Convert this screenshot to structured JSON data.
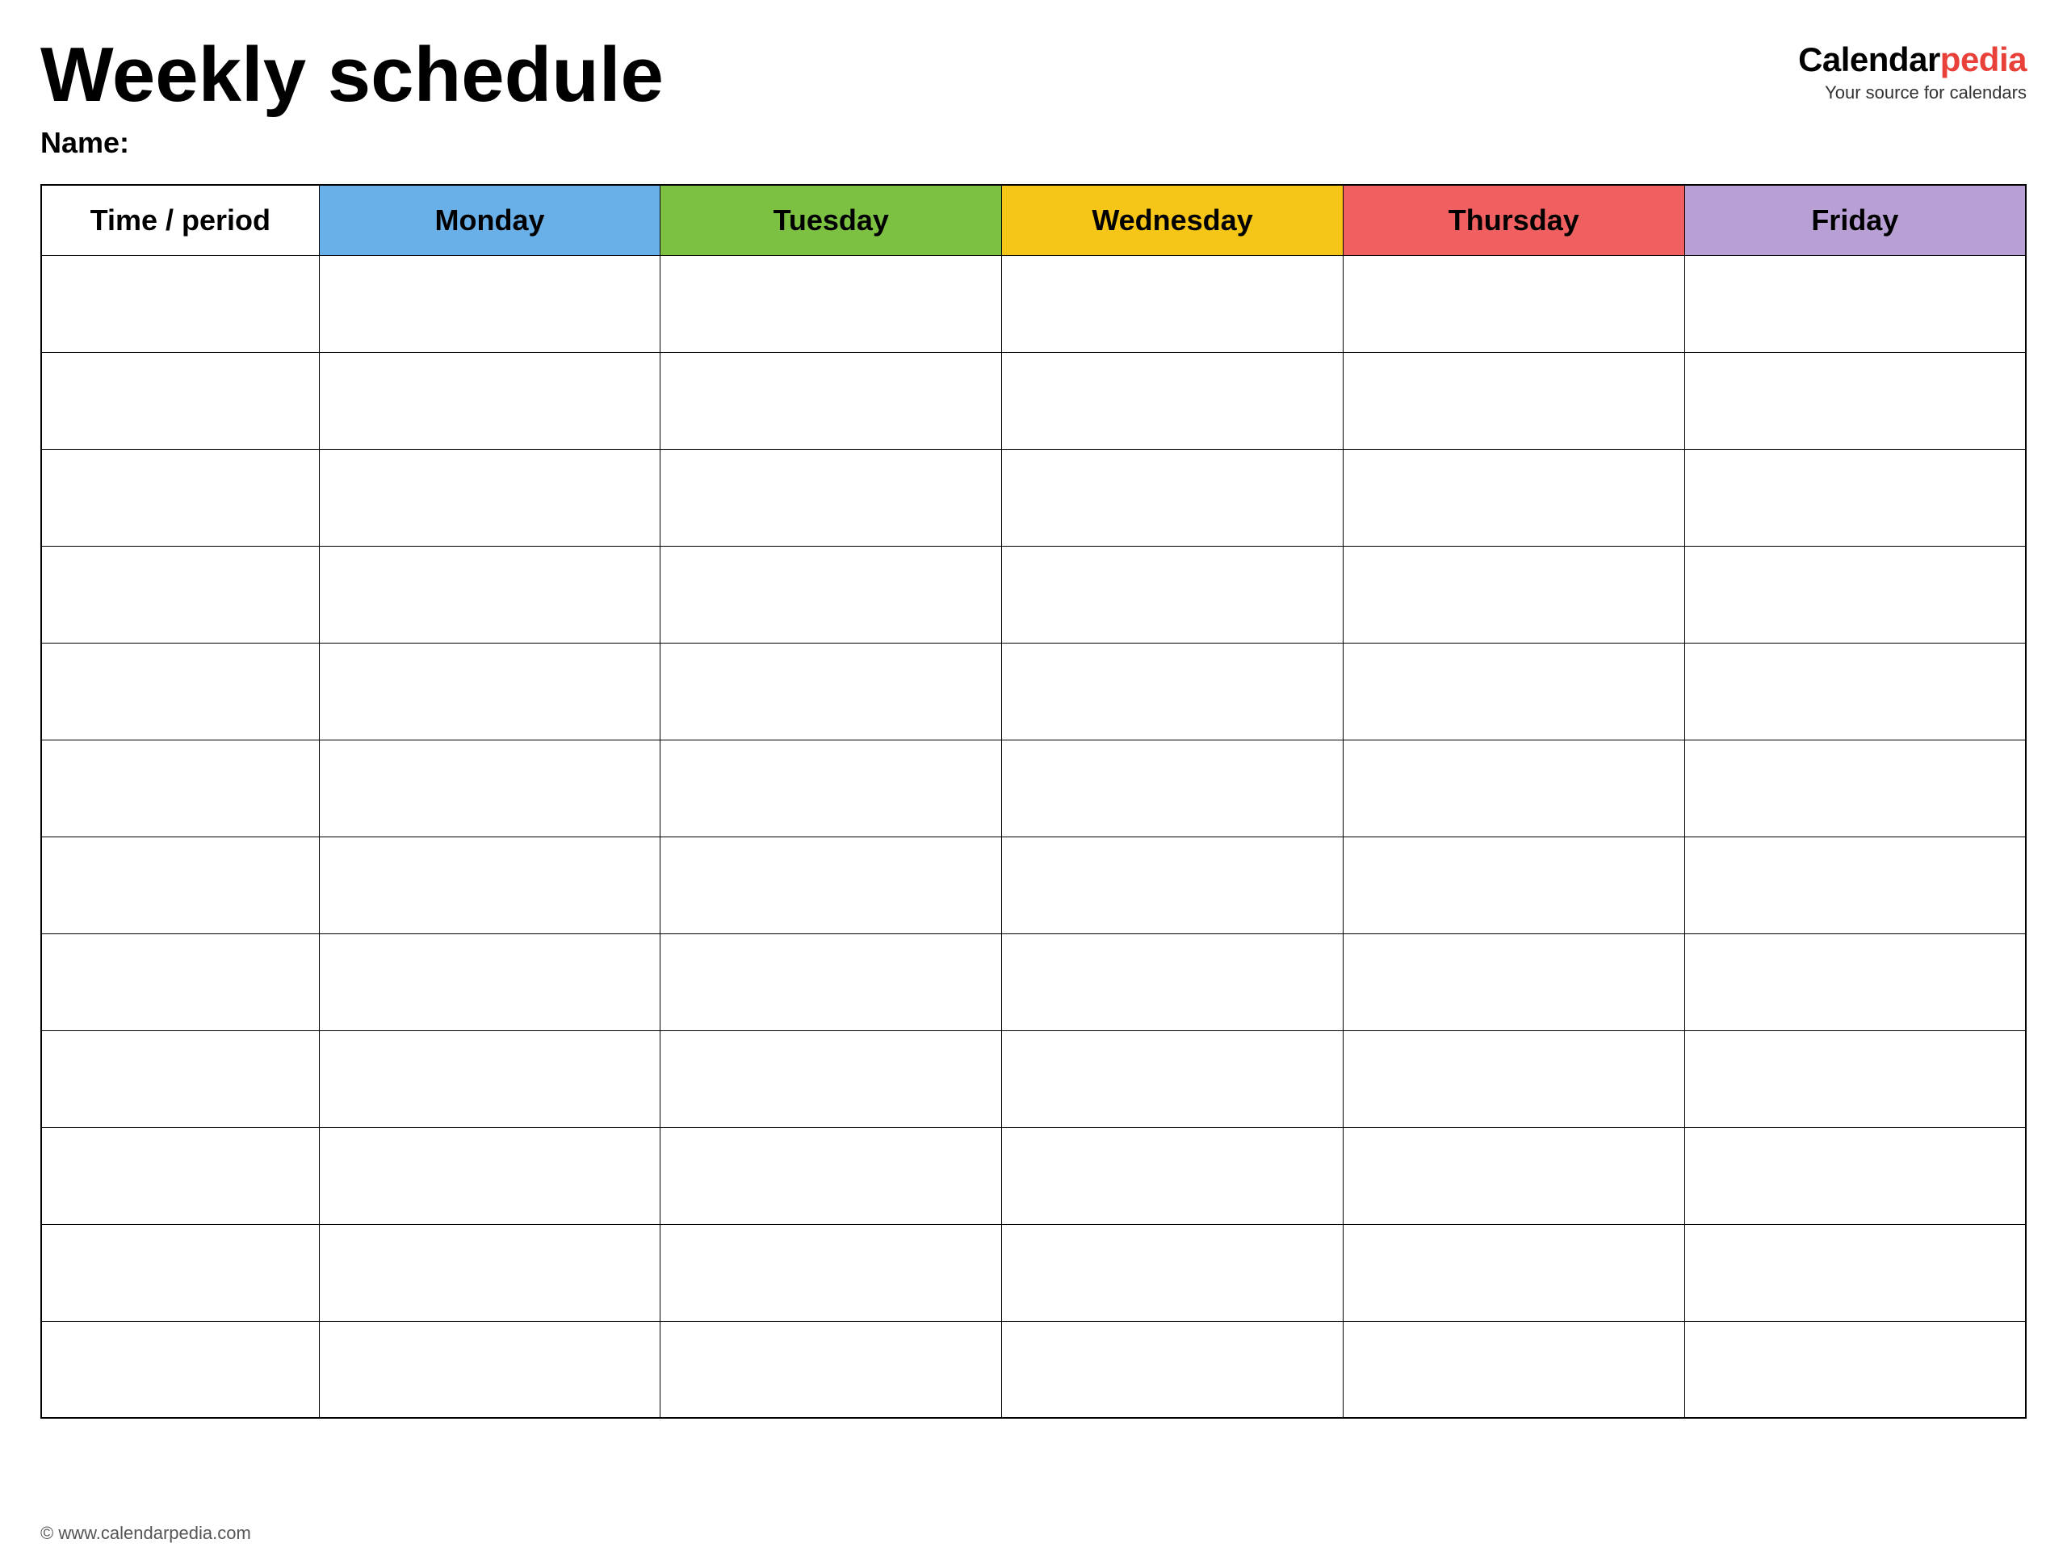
{
  "header": {
    "title": "Weekly schedule",
    "name_label": "Name:",
    "logo_calendar": "Calendar",
    "logo_pedia": "pedia",
    "logo_tagline": "Your source for calendars"
  },
  "table": {
    "columns": [
      {
        "key": "time",
        "label": "Time / period",
        "class": "col-time"
      },
      {
        "key": "monday",
        "label": "Monday",
        "class": "col-monday"
      },
      {
        "key": "tuesday",
        "label": "Tuesday",
        "class": "col-tuesday"
      },
      {
        "key": "wednesday",
        "label": "Wednesday",
        "class": "col-wednesday"
      },
      {
        "key": "thursday",
        "label": "Thursday",
        "class": "col-thursday"
      },
      {
        "key": "friday",
        "label": "Friday",
        "class": "col-friday"
      }
    ],
    "row_count": 12
  },
  "footer": {
    "url": "© www.calendarpedia.com"
  }
}
